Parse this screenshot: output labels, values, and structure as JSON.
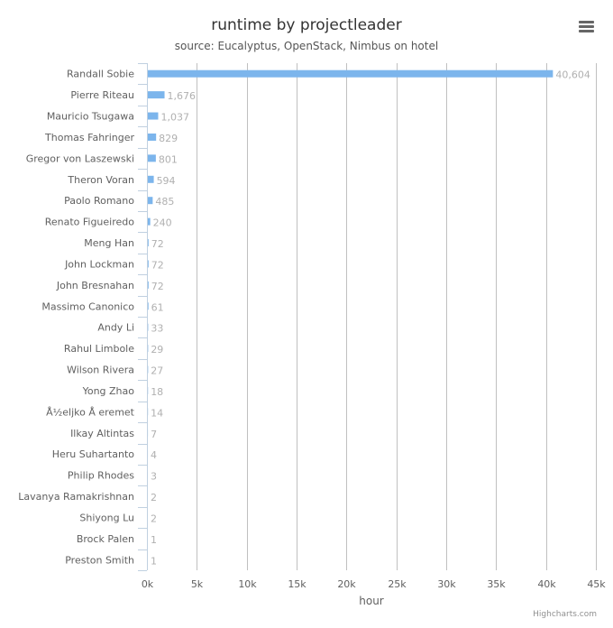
{
  "chart_data": {
    "type": "bar",
    "orientation": "horizontal",
    "title": "runtime by projectleader",
    "subtitle": "source: Eucalyptus, OpenStack, Nimbus on hotel",
    "xlabel": "hour",
    "ylabel": "",
    "categories": [
      "Randall Sobie",
      "Pierre Riteau",
      "Mauricio Tsugawa",
      "Thomas Fahringer",
      "Gregor von Laszewski",
      "Theron Voran",
      "Paolo Romano",
      "Renato Figueiredo",
      "Meng Han",
      "John Lockman",
      "John Bresnahan",
      "Massimo Canonico",
      "Andy Li",
      "Rahul Limbole",
      "Wilson Rivera",
      "Yong Zhao",
      "Å½eljko Å eremet",
      "Ilkay Altintas",
      "Heru Suhartanto",
      "Philip Rhodes",
      "Lavanya Ramakrishnan",
      "Shiyong Lu",
      "Brock Palen",
      "Preston Smith"
    ],
    "values": [
      40604,
      1676,
      1037,
      829,
      801,
      594,
      485,
      240,
      72,
      72,
      72,
      61,
      33,
      29,
      27,
      18,
      14,
      7,
      4,
      3,
      2,
      2,
      1,
      1
    ],
    "data_labels": [
      "40,604",
      "1,676",
      "1,037",
      "829",
      "801",
      "594",
      "485",
      "240",
      "72",
      "72",
      "72",
      "61",
      "33",
      "29",
      "27",
      "18",
      "14",
      "7",
      "4",
      "3",
      "2",
      "2",
      "1",
      "1"
    ],
    "xlim": [
      0,
      45000
    ],
    "x_ticks": [
      0,
      5000,
      10000,
      15000,
      20000,
      25000,
      30000,
      35000,
      40000,
      45000
    ],
    "x_tick_labels": [
      "0k",
      "5k",
      "10k",
      "15k",
      "20k",
      "25k",
      "30k",
      "35k",
      "40k",
      "45k"
    ],
    "grid": true,
    "legend": "none",
    "bar_color": "#7cb5ec",
    "credits": "Highcharts.com"
  },
  "menu": {
    "icon": "hamburger-menu-icon"
  }
}
